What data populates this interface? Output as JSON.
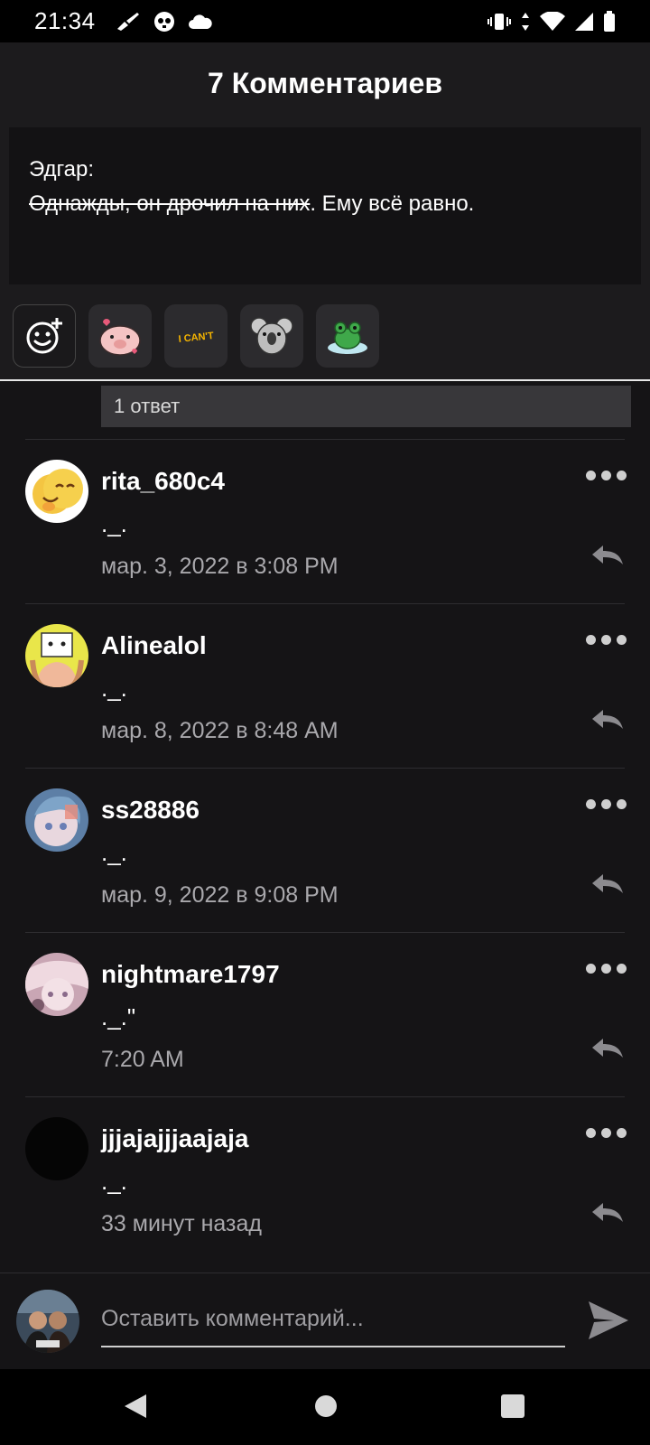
{
  "status": {
    "time": "21:34"
  },
  "header": {
    "title": "7 Комментариев"
  },
  "quote": {
    "author": "Эдгар:",
    "struck_text": "Однажды, он дрочил на них",
    "text": ". Ему всё равно."
  },
  "sticker_bar": {
    "items": [
      "emoji-add-icon",
      "pig-sticker",
      "i-cant-sticker",
      "koala-sticker",
      "frog-sticker"
    ],
    "i_cant_text": "I CAN'T"
  },
  "reply_count": "1 ответ",
  "comments": [
    {
      "username": "rita_680c4",
      "text": "._.",
      "time": "мар. 3, 2022 в 3:08 PM",
      "avatar_color": "#f4c542"
    },
    {
      "username": "Alinealol",
      "text": "._.",
      "time": "мар. 8, 2022 в 8:48 AM",
      "avatar_color": "#e9e64a"
    },
    {
      "username": "ss28886",
      "text": "._.",
      "time": "мар. 9, 2022 в 9:08 PM",
      "avatar_color": "#5d7fa6"
    },
    {
      "username": "nightmare1797",
      "text": "._.\"",
      "time": "7:20 AM",
      "avatar_color": "#c9a6b4"
    },
    {
      "username": "jjjajajjjaajaja",
      "text": "._.",
      "time": "33 минут назад",
      "avatar_color": "#050505"
    }
  ],
  "composer": {
    "placeholder": "Оставить комментарий..."
  },
  "colors": {
    "background": "#151416",
    "header": "#1c1b1d",
    "accent_text": "#a9a8ac"
  }
}
